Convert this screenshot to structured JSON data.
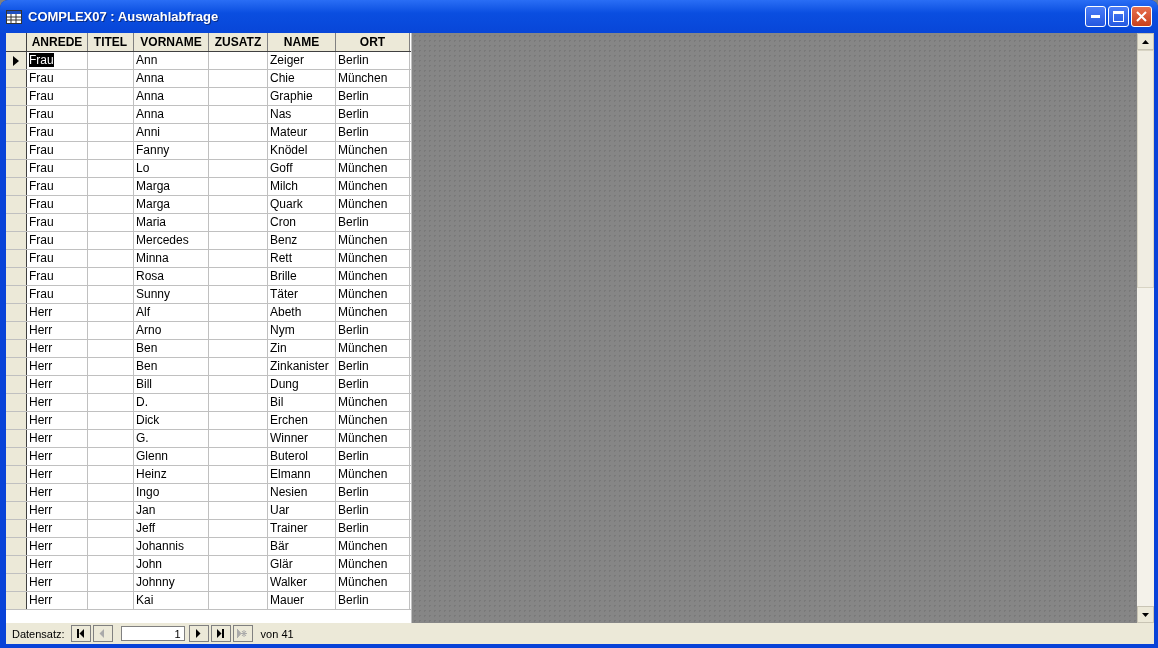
{
  "window": {
    "title": "COMPLEX07 : Auswahlabfrage"
  },
  "table": {
    "columns": [
      "ANREDE",
      "TITEL",
      "VORNAME",
      "ZUSATZ",
      "NAME",
      "ORT"
    ],
    "rows": [
      {
        "selected": true,
        "cells": [
          "Frau",
          null,
          "Ann",
          null,
          "Zeiger",
          "Berlin"
        ]
      },
      {
        "selected": false,
        "cells": [
          "Frau",
          null,
          "Anna",
          null,
          "Chie",
          "München"
        ]
      },
      {
        "selected": false,
        "cells": [
          "Frau",
          null,
          "Anna",
          null,
          "Graphie",
          "Berlin"
        ]
      },
      {
        "selected": false,
        "cells": [
          "Frau",
          null,
          "Anna",
          null,
          "Nas",
          "Berlin"
        ]
      },
      {
        "selected": false,
        "cells": [
          "Frau",
          null,
          "Anni",
          null,
          "Mateur",
          "Berlin"
        ]
      },
      {
        "selected": false,
        "cells": [
          "Frau",
          null,
          "Fanny",
          null,
          "Knödel",
          "München"
        ]
      },
      {
        "selected": false,
        "cells": [
          "Frau",
          null,
          "Lo",
          null,
          "Goff",
          "München"
        ]
      },
      {
        "selected": false,
        "cells": [
          "Frau",
          null,
          "Marga",
          null,
          "Milch",
          "München"
        ]
      },
      {
        "selected": false,
        "cells": [
          "Frau",
          null,
          "Marga",
          null,
          "Quark",
          "München"
        ]
      },
      {
        "selected": false,
        "cells": [
          "Frau",
          null,
          "Maria",
          null,
          "Cron",
          "Berlin"
        ]
      },
      {
        "selected": false,
        "cells": [
          "Frau",
          null,
          "Mercedes",
          null,
          "Benz",
          "München"
        ]
      },
      {
        "selected": false,
        "cells": [
          "Frau",
          null,
          "Minna",
          null,
          "Rett",
          "München"
        ]
      },
      {
        "selected": false,
        "cells": [
          "Frau",
          null,
          "Rosa",
          null,
          "Brille",
          "München"
        ]
      },
      {
        "selected": false,
        "cells": [
          "Frau",
          null,
          "Sunny",
          null,
          "Täter",
          "München"
        ]
      },
      {
        "selected": false,
        "cells": [
          "Herr",
          null,
          "Alf",
          null,
          "Abeth",
          "München"
        ]
      },
      {
        "selected": false,
        "cells": [
          "Herr",
          null,
          "Arno",
          null,
          "Nym",
          "Berlin"
        ]
      },
      {
        "selected": false,
        "cells": [
          "Herr",
          null,
          "Ben",
          null,
          "Zin",
          "München"
        ]
      },
      {
        "selected": false,
        "cells": [
          "Herr",
          null,
          "Ben",
          null,
          "Zinkanister",
          "Berlin"
        ]
      },
      {
        "selected": false,
        "cells": [
          "Herr",
          null,
          "Bill",
          null,
          "Dung",
          "Berlin"
        ]
      },
      {
        "selected": false,
        "cells": [
          "Herr",
          null,
          "D.",
          null,
          "Bil",
          "München"
        ]
      },
      {
        "selected": false,
        "cells": [
          "Herr",
          null,
          "Dick",
          null,
          "Erchen",
          "München"
        ]
      },
      {
        "selected": false,
        "cells": [
          "Herr",
          null,
          "G.",
          null,
          "Winner",
          "München"
        ]
      },
      {
        "selected": false,
        "cells": [
          "Herr",
          null,
          "Glenn",
          null,
          "Buterol",
          "Berlin"
        ]
      },
      {
        "selected": false,
        "cells": [
          "Herr",
          null,
          "Heinz",
          null,
          "Elmann",
          "München"
        ]
      },
      {
        "selected": false,
        "cells": [
          "Herr",
          null,
          "Ingo",
          null,
          "Nesien",
          "Berlin"
        ]
      },
      {
        "selected": false,
        "cells": [
          "Herr",
          null,
          "Jan",
          null,
          "Uar",
          "Berlin"
        ]
      },
      {
        "selected": false,
        "cells": [
          "Herr",
          null,
          "Jeff",
          null,
          "Trainer",
          "Berlin"
        ]
      },
      {
        "selected": false,
        "cells": [
          "Herr",
          null,
          "Johannis",
          null,
          "Bär",
          "München"
        ]
      },
      {
        "selected": false,
        "cells": [
          "Herr",
          null,
          "John",
          null,
          "Glär",
          "München"
        ]
      },
      {
        "selected": false,
        "cells": [
          "Herr",
          null,
          "Johnny",
          null,
          "Walker",
          "München"
        ]
      },
      {
        "selected": false,
        "cells": [
          "Herr",
          null,
          "Kai",
          null,
          "Mauer",
          "Berlin"
        ]
      }
    ]
  },
  "navigation": {
    "label": "Datensatz:",
    "buttons": [
      {
        "kind": "first",
        "disabled": false
      },
      {
        "kind": "prev",
        "disabled": true
      }
    ],
    "record": "1",
    "buttons_after": [
      {
        "kind": "next",
        "disabled": false
      },
      {
        "kind": "last",
        "disabled": false
      },
      {
        "kind": "new",
        "disabled": true
      }
    ],
    "total": "von 41"
  }
}
